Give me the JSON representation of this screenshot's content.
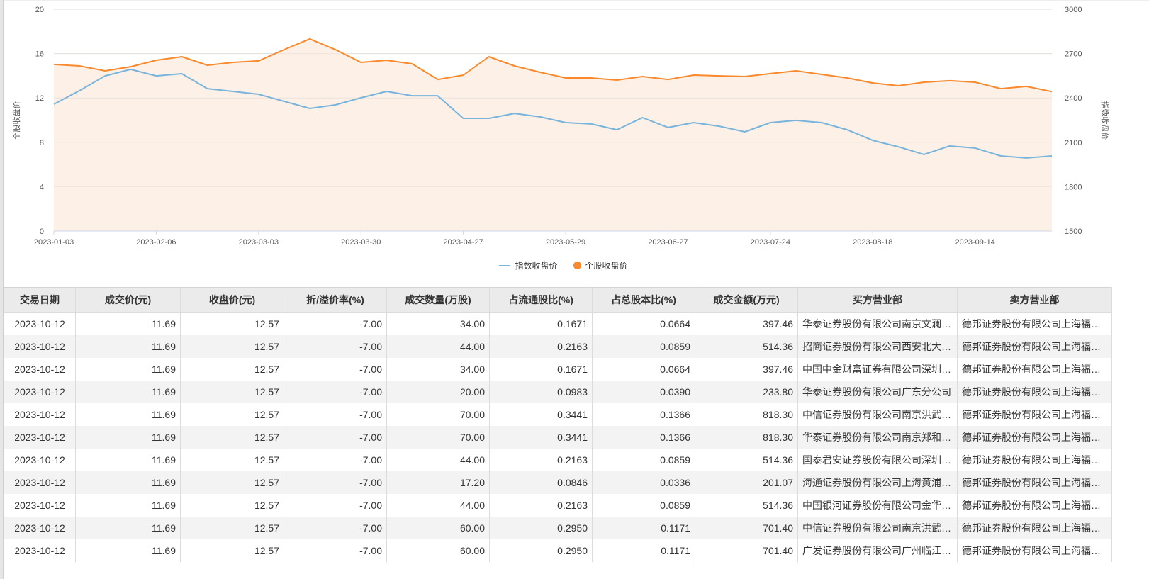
{
  "chart_data": {
    "type": "line",
    "x": [
      "2023-01-03",
      "2023-01-11",
      "2023-01-19",
      "2023-01-30",
      "2023-02-06",
      "2023-02-12",
      "2023-02-17",
      "2023-02-24",
      "2023-03-03",
      "2023-03-09",
      "2023-03-16",
      "2023-03-23",
      "2023-03-30",
      "2023-04-06",
      "2023-04-13",
      "2023-04-20",
      "2023-04-27",
      "2023-05-08",
      "2023-05-15",
      "2023-05-22",
      "2023-05-29",
      "2023-06-05",
      "2023-06-12",
      "2023-06-19",
      "2023-06-27",
      "2023-07-03",
      "2023-07-10",
      "2023-07-17",
      "2023-07-24",
      "2023-07-31",
      "2023-08-04",
      "2023-08-11",
      "2023-08-18",
      "2023-08-25",
      "2023-09-01",
      "2023-09-07",
      "2023-09-14",
      "2023-09-21",
      "2023-09-28",
      "2023-10-12"
    ],
    "x_ticks": [
      "2023-01-03",
      "2023-02-06",
      "2023-03-03",
      "2023-03-30",
      "2023-04-27",
      "2023-05-29",
      "2023-06-27",
      "2023-07-24",
      "2023-08-18",
      "2023-09-14"
    ],
    "y_left": {
      "label": "个股收盘价",
      "range": [
        0,
        20
      ],
      "ticks": [
        "0",
        "4",
        "8",
        "12",
        "16",
        "20"
      ]
    },
    "y_right": {
      "label": "指数收盘价",
      "range": [
        1500,
        3000
      ],
      "ticks": [
        "1500",
        "1800",
        "2100",
        "2400",
        "2700",
        "3000"
      ]
    },
    "grid": true,
    "legend": "bottom",
    "series": [
      {
        "name": "指数收盘价",
        "axis": "right",
        "color": "#78b4dc",
        "area": false,
        "values": [
          2358,
          2449,
          2549,
          2593,
          2549,
          2564,
          2463,
          2444,
          2425,
          2377,
          2329,
          2353,
          2401,
          2444,
          2415,
          2415,
          2262,
          2262,
          2295,
          2272,
          2233,
          2224,
          2185,
          2267,
          2200,
          2233,
          2209,
          2171,
          2233,
          2248,
          2233,
          2185,
          2113,
          2070,
          2018,
          2075,
          2061,
          2008,
          1994,
          2008
        ]
      },
      {
        "name": "个股收盘价",
        "axis": "left",
        "color": "#f9892c",
        "area": true,
        "area_color": "#fdf0e6",
        "values": [
          15.02,
          14.89,
          14.44,
          14.82,
          15.4,
          15.72,
          14.95,
          15.21,
          15.34,
          16.36,
          17.32,
          16.36,
          15.21,
          15.4,
          15.08,
          13.67,
          14.06,
          15.72,
          14.89,
          14.31,
          13.8,
          13.8,
          13.61,
          13.93,
          13.67,
          14.06,
          13.99,
          13.93,
          14.19,
          14.44,
          14.12,
          13.8,
          13.35,
          13.1,
          13.42,
          13.55,
          13.42,
          12.84,
          13.04,
          12.57
        ]
      }
    ]
  },
  "table": {
    "headers": [
      "交易日期",
      "成交价(元)",
      "收盘价(元)",
      "折/溢价率(%)",
      "成交数量(万股)",
      "占流通股比(%)",
      "占总股本比(%)",
      "成交金额(万元)",
      "买方营业部",
      "卖方营业部"
    ],
    "rows": [
      [
        "2023-10-12",
        "11.69",
        "12.57",
        "-7.00",
        "34.00",
        "0.1671",
        "0.0664",
        "397.46",
        "华泰证券股份有限公司南京文澜…",
        "德邦证券股份有限公司上海福…"
      ],
      [
        "2023-10-12",
        "11.69",
        "12.57",
        "-7.00",
        "44.00",
        "0.2163",
        "0.0859",
        "514.36",
        "招商证券股份有限公司西安北大…",
        "德邦证券股份有限公司上海福…"
      ],
      [
        "2023-10-12",
        "11.69",
        "12.57",
        "-7.00",
        "34.00",
        "0.1671",
        "0.0664",
        "397.46",
        "中国中金财富证券有限公司深圳…",
        "德邦证券股份有限公司上海福…"
      ],
      [
        "2023-10-12",
        "11.69",
        "12.57",
        "-7.00",
        "20.00",
        "0.0983",
        "0.0390",
        "233.80",
        "华泰证券股份有限公司广东分公司",
        "德邦证券股份有限公司上海福…"
      ],
      [
        "2023-10-12",
        "11.69",
        "12.57",
        "-7.00",
        "70.00",
        "0.3441",
        "0.1366",
        "818.30",
        "中信证券股份有限公司南京洪武…",
        "德邦证券股份有限公司上海福…"
      ],
      [
        "2023-10-12",
        "11.69",
        "12.57",
        "-7.00",
        "70.00",
        "0.3441",
        "0.1366",
        "818.30",
        "华泰证券股份有限公司南京郑和…",
        "德邦证券股份有限公司上海福…"
      ],
      [
        "2023-10-12",
        "11.69",
        "12.57",
        "-7.00",
        "44.00",
        "0.2163",
        "0.0859",
        "514.36",
        "国泰君安证券股份有限公司深圳…",
        "德邦证券股份有限公司上海福…"
      ],
      [
        "2023-10-12",
        "11.69",
        "12.57",
        "-7.00",
        "17.20",
        "0.0846",
        "0.0336",
        "201.07",
        "海通证券股份有限公司上海黄浦…",
        "德邦证券股份有限公司上海福…"
      ],
      [
        "2023-10-12",
        "11.69",
        "12.57",
        "-7.00",
        "44.00",
        "0.2163",
        "0.0859",
        "514.36",
        "中国银河证券股份有限公司金华…",
        "德邦证券股份有限公司上海福…"
      ],
      [
        "2023-10-12",
        "11.69",
        "12.57",
        "-7.00",
        "60.00",
        "0.2950",
        "0.1171",
        "701.40",
        "中信证券股份有限公司南京洪武…",
        "德邦证券股份有限公司上海福…"
      ],
      [
        "2023-10-12",
        "11.69",
        "12.57",
        "-7.00",
        "60.00",
        "0.2950",
        "0.1171",
        "701.40",
        "广发证券股份有限公司广州临江…",
        "德邦证券股份有限公司上海福…"
      ]
    ]
  }
}
